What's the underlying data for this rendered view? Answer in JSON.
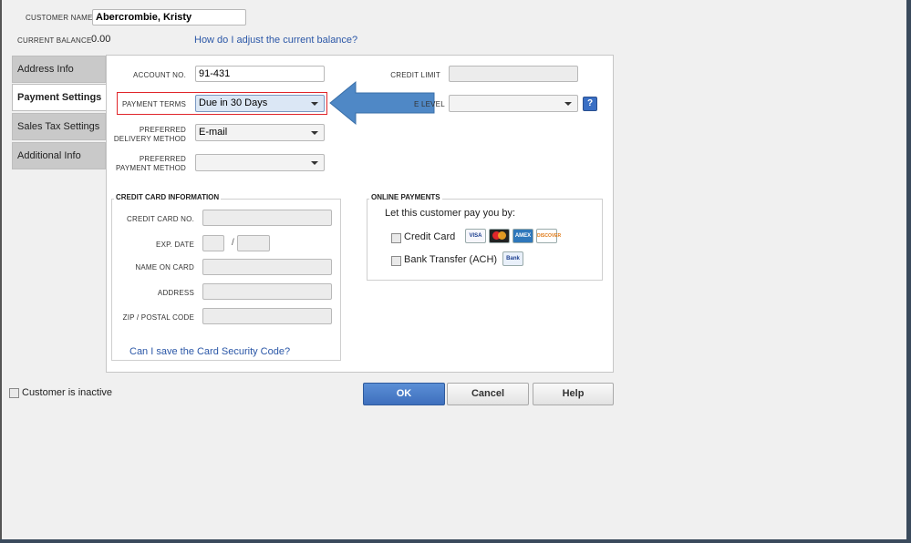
{
  "header": {
    "customer_name_label": "CUSTOMER NAME",
    "customer_name_value": "Abercrombie, Kristy",
    "current_balance_label": "CURRENT BALANCE",
    "current_balance_value": "0.00",
    "adjust_balance_link": "How do I adjust the current balance?"
  },
  "tabs": [
    {
      "label": "Address Info"
    },
    {
      "label": "Payment Settings"
    },
    {
      "label": "Sales Tax Settings"
    },
    {
      "label": "Additional Info"
    }
  ],
  "form": {
    "account_no_label": "ACCOUNT NO.",
    "account_no_value": "91-431",
    "credit_limit_label": "CREDIT LIMIT",
    "credit_limit_value": "",
    "payment_terms_label": "PAYMENT TERMS",
    "payment_terms_value": "Due in 30 Days",
    "price_level_label": "E LEVEL",
    "price_level_value": "",
    "help_label": "?",
    "delivery_method_label_1": "PREFERRED",
    "delivery_method_label_2": "DELIVERY METHOD",
    "delivery_method_value": "E-mail",
    "payment_method_label_1": "PREFERRED",
    "payment_method_label_2": "PAYMENT METHOD",
    "payment_method_value": ""
  },
  "credit_card": {
    "title": "CREDIT CARD INFORMATION",
    "card_no_label": "CREDIT CARD NO.",
    "exp_date_label": "EXP. DATE",
    "exp_separator": "/",
    "name_label": "NAME ON CARD",
    "address_label": "ADDRESS",
    "zip_label": "ZIP / POSTAL CODE",
    "security_link": "Can I save the Card Security Code?"
  },
  "online_payments": {
    "title": "ONLINE PAYMENTS",
    "subtitle": "Let this customer pay you by:",
    "credit_card_label": "Credit Card",
    "bank_transfer_label": "Bank Transfer (ACH)",
    "card_icons": [
      "VISA",
      "MC",
      "AMEX",
      "DISCOVER"
    ],
    "bank_icon": "Bank"
  },
  "footer": {
    "inactive_label": "Customer is inactive",
    "ok_label": "OK",
    "cancel_label": "Cancel",
    "help_label": "Help"
  },
  "colors": {
    "annotation_arrow": "#4f88c6",
    "highlight_box": "#e0262b",
    "link": "#2b57a7"
  }
}
